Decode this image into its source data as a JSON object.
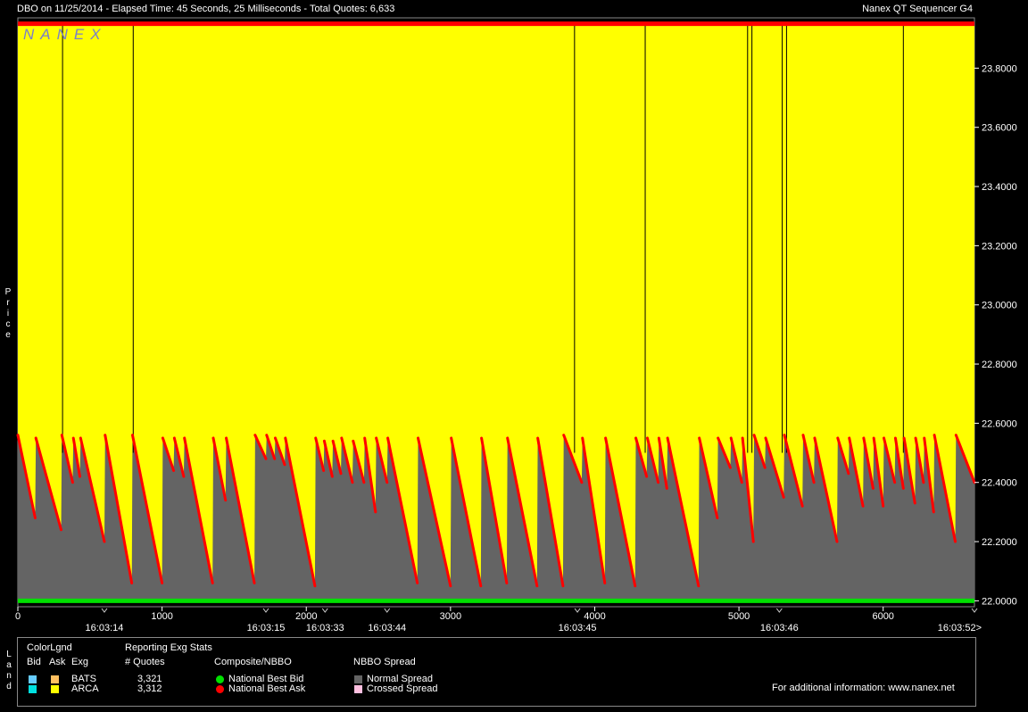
{
  "header": {
    "info": "DBO on 11/25/2014  -  Elapsed Time: 45 Seconds, 25 Milliseconds  -  Total Quotes: 6,633",
    "product": "Nanex QT Sequencer G4"
  },
  "watermark": "NANEX",
  "axis": {
    "y_label": "Price",
    "y_ticks": [
      "22.0000",
      "22.2000",
      "22.4000",
      "22.6000",
      "22.8000",
      "23.0000",
      "23.2000",
      "23.4000",
      "23.6000",
      "23.8000"
    ],
    "x_ticks": [
      "0",
      "1000",
      "2000",
      "3000",
      "4000",
      "5000",
      "6000"
    ],
    "time_labels": [
      "16:03:14",
      "16:03:15",
      "16:03:33",
      "16:03:44",
      "16:03:45",
      "16:03:46",
      "16:03:52>"
    ]
  },
  "chart_data": {
    "type": "area",
    "x_range": [
      0,
      6633
    ],
    "ylim": [
      21.98,
      23.97
    ],
    "y_ticks": [
      22.0,
      22.2,
      22.4,
      22.6,
      22.8,
      23.0,
      23.2,
      23.4,
      23.6,
      23.8
    ],
    "x_ticks": [
      0,
      1000,
      2000,
      3000,
      4000,
      5000,
      6000
    ],
    "time_marks": [
      {
        "x": 600,
        "label": "16:03:14"
      },
      {
        "x": 1720,
        "label": "16:03:15"
      },
      {
        "x": 2130,
        "label": "16:03:33"
      },
      {
        "x": 2560,
        "label": "16:03:44"
      },
      {
        "x": 3880,
        "label": "16:03:45"
      },
      {
        "x": 5280,
        "label": "16:03:46"
      },
      {
        "x": 6633,
        "label": "16:03:52>"
      }
    ],
    "national_best_bid": 22.0,
    "national_best_ask_upper": 23.95,
    "ask_cycles": [
      [
        0,
        22.56,
        120,
        22.28
      ],
      [
        125,
        22.55,
        300,
        22.24
      ],
      [
        305,
        22.56,
        380,
        22.4
      ],
      [
        385,
        22.55,
        430,
        22.42
      ],
      [
        435,
        22.55,
        600,
        22.2
      ],
      [
        605,
        22.56,
        790,
        22.06
      ],
      [
        795,
        22.56,
        1000,
        22.06
      ],
      [
        1005,
        22.55,
        1080,
        22.44
      ],
      [
        1085,
        22.55,
        1150,
        22.42
      ],
      [
        1155,
        22.55,
        1350,
        22.06
      ],
      [
        1355,
        22.55,
        1440,
        22.34
      ],
      [
        1445,
        22.55,
        1640,
        22.06
      ],
      [
        1645,
        22.56,
        1720,
        22.48
      ],
      [
        1725,
        22.56,
        1780,
        22.48
      ],
      [
        1785,
        22.55,
        1850,
        22.46
      ],
      [
        1855,
        22.55,
        2060,
        22.05
      ],
      [
        2065,
        22.55,
        2120,
        22.44
      ],
      [
        2125,
        22.54,
        2180,
        22.42
      ],
      [
        2185,
        22.54,
        2240,
        22.43
      ],
      [
        2245,
        22.55,
        2320,
        22.4
      ],
      [
        2325,
        22.54,
        2400,
        22.4
      ],
      [
        2405,
        22.55,
        2480,
        22.3
      ],
      [
        2485,
        22.55,
        2560,
        22.4
      ],
      [
        2565,
        22.55,
        2770,
        22.06
      ],
      [
        2775,
        22.55,
        3000,
        22.05
      ],
      [
        3005,
        22.55,
        3210,
        22.05
      ],
      [
        3215,
        22.55,
        3390,
        22.06
      ],
      [
        3395,
        22.55,
        3600,
        22.05
      ],
      [
        3605,
        22.55,
        3780,
        22.05
      ],
      [
        3785,
        22.56,
        3910,
        22.4
      ],
      [
        3915,
        22.55,
        4070,
        22.06
      ],
      [
        4075,
        22.55,
        4280,
        22.05
      ],
      [
        4285,
        22.55,
        4360,
        22.42
      ],
      [
        4365,
        22.55,
        4440,
        22.4
      ],
      [
        4445,
        22.55,
        4500,
        22.38
      ],
      [
        4505,
        22.55,
        4720,
        22.05
      ],
      [
        4725,
        22.55,
        4850,
        22.28
      ],
      [
        4855,
        22.55,
        4940,
        22.45
      ],
      [
        4945,
        22.55,
        5020,
        22.4
      ],
      [
        5025,
        22.55,
        5100,
        22.2
      ],
      [
        5105,
        22.56,
        5180,
        22.45
      ],
      [
        5185,
        22.55,
        5310,
        22.35
      ],
      [
        5315,
        22.56,
        5440,
        22.32
      ],
      [
        5445,
        22.56,
        5520,
        22.4
      ],
      [
        5525,
        22.55,
        5680,
        22.2
      ],
      [
        5685,
        22.55,
        5760,
        22.43
      ],
      [
        5765,
        22.55,
        5860,
        22.32
      ],
      [
        5865,
        22.55,
        5930,
        22.38
      ],
      [
        5935,
        22.55,
        6000,
        22.32
      ],
      [
        6005,
        22.55,
        6080,
        22.4
      ],
      [
        6085,
        22.55,
        6140,
        22.38
      ],
      [
        6145,
        22.55,
        6220,
        22.33
      ],
      [
        6225,
        22.55,
        6280,
        22.4
      ],
      [
        6285,
        22.55,
        6350,
        22.3
      ],
      [
        6355,
        22.56,
        6500,
        22.2
      ],
      [
        6505,
        22.56,
        6633,
        22.4
      ]
    ],
    "spikes_x": [
      310,
      800,
      3860,
      4350,
      5060,
      5090,
      5300,
      5330,
      6140
    ],
    "colors": {
      "ask_area": "#ffff00",
      "spread_area": "#646464",
      "bid_line": "#00e000",
      "ask_line": "#ff0000",
      "axis_bg": "#000000",
      "spike": "#000000"
    }
  },
  "legend": {
    "side_label": "Land",
    "color_legend_title": "ColorLgnd",
    "col_bid": "Bid",
    "col_ask": "Ask",
    "col_exg": "Exg",
    "stats_title": "Reporting Exg Stats",
    "quotes_header": "# Quotes",
    "exchanges": [
      {
        "name": "BATS",
        "quotes": "3,321",
        "bid_color": "#66ccff",
        "ask_color": "#ffc060"
      },
      {
        "name": "ARCA",
        "quotes": "3,312",
        "bid_color": "#00e0e0",
        "ask_color": "#ffff00"
      }
    ],
    "composite_title": "Composite/NBBO",
    "composite_items": [
      {
        "label": "National Best Bid",
        "color": "#00e000"
      },
      {
        "label": "National Best Ask",
        "color": "#ff0000"
      }
    ],
    "spread_title": "NBBO Spread",
    "spread_items": [
      {
        "label": "Normal Spread",
        "color": "#646464"
      },
      {
        "label": "Crossed Spread",
        "color": "#ffc0e0"
      }
    ],
    "footer": "For additional information: www.nanex.net"
  }
}
